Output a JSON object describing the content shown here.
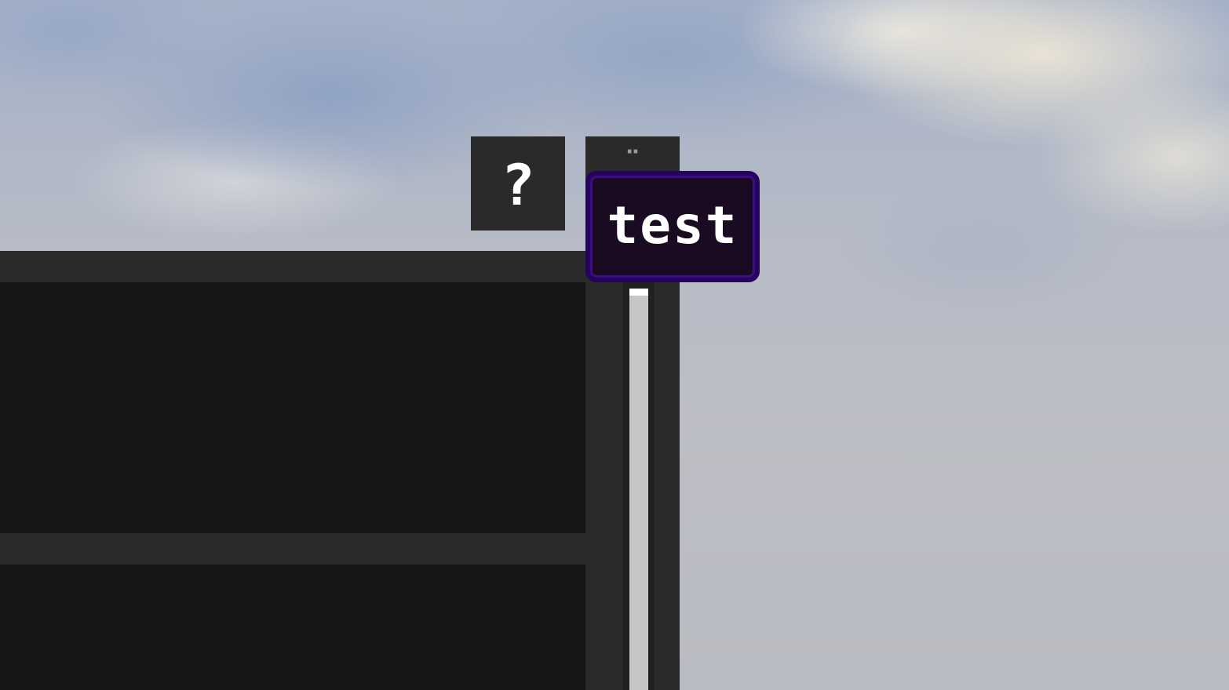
{
  "background": {
    "name": "sky-panorama"
  },
  "buttons": {
    "help_label": "?",
    "second_label": "¨"
  },
  "tooltip": {
    "text": "test",
    "bg_color": "#1a0b22",
    "border_color": "#3a0e86"
  },
  "panel": {
    "bg_color": "#2a2a2a",
    "slot_color": "#161616"
  },
  "scrollbar": {
    "thumb_color": "#c6c6c6"
  }
}
